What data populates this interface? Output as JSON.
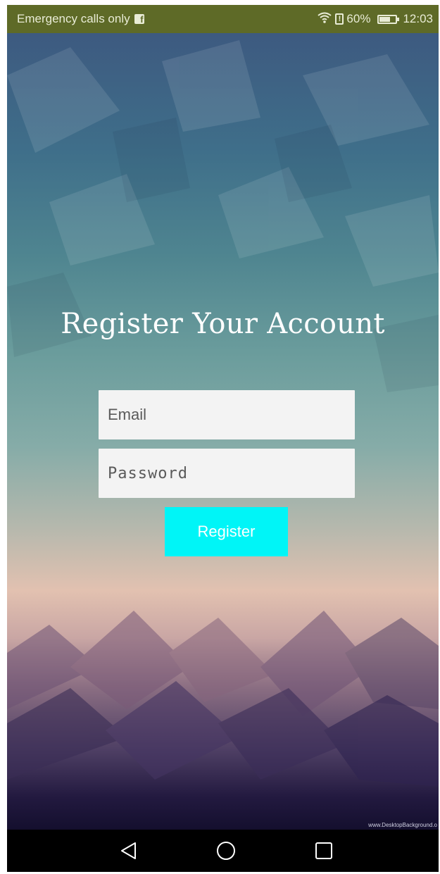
{
  "status_bar": {
    "carrier": "Emergency calls only",
    "battery_percent": "60%",
    "time": "12:03",
    "icons": [
      "facebook-icon",
      "wifi-icon",
      "alert-icon",
      "battery-icon"
    ]
  },
  "form": {
    "title": "Register Your Account",
    "email_placeholder": "Email",
    "password_placeholder": "Password",
    "register_label": "Register",
    "register_color": "#00f5f7"
  },
  "watermark": "www.DesktopBackground.o",
  "nav_bar": {
    "icons": [
      "back-icon",
      "home-icon",
      "recents-icon"
    ]
  },
  "colors": {
    "status_bar": "#5e6a27",
    "background_top": "#3d5a80",
    "background_bottom": "#140f2e"
  }
}
